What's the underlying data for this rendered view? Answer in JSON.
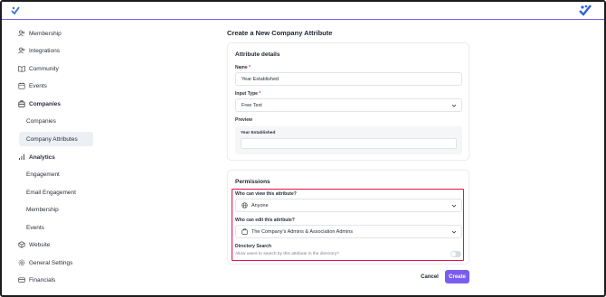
{
  "sidebar": {
    "items": [
      {
        "label": "Membership",
        "icon": "users-icon"
      },
      {
        "label": "Integrations",
        "icon": "users-icon"
      },
      {
        "label": "Community",
        "icon": "book-icon"
      },
      {
        "label": "Events",
        "icon": "calendar-icon"
      },
      {
        "label": "Companies",
        "icon": "building-icon"
      },
      {
        "label": "Companies"
      },
      {
        "label": "Company Attributes"
      },
      {
        "label": "Analytics",
        "icon": "bar-chart-icon"
      },
      {
        "label": "Engagement"
      },
      {
        "label": "Email Engagement"
      },
      {
        "label": "Membership"
      },
      {
        "label": "Events"
      },
      {
        "label": "Website",
        "icon": "globe-icon"
      },
      {
        "label": "General Settings",
        "icon": "gear-icon"
      },
      {
        "label": "Financials",
        "icon": "card-icon"
      }
    ]
  },
  "main": {
    "page_title": "Create a New Company Attribute",
    "details": {
      "title": "Attribute details",
      "name_label": "Name",
      "required_mark": "*",
      "name_value": "Year Established",
      "input_type_label": "Input Type",
      "input_type_value": "Free Text",
      "preview_label": "Preview",
      "preview_field_label": "Year Established"
    },
    "permissions": {
      "title": "Permissions",
      "view_label": "Who can view this attribute?",
      "view_value": "Anyone",
      "edit_label": "Who can edit this attribute?",
      "edit_value": "The Company's Admins & Association Admins",
      "directory_label": "Directory Search",
      "directory_help": "Allow users to search by this attribute in the directory?",
      "directory_enabled": false
    },
    "actions": {
      "cancel": "Cancel",
      "create": "Create"
    }
  },
  "colors": {
    "accent": "#7b5cf0",
    "highlight": "#e3124d",
    "active_bg": "#eceff3"
  }
}
